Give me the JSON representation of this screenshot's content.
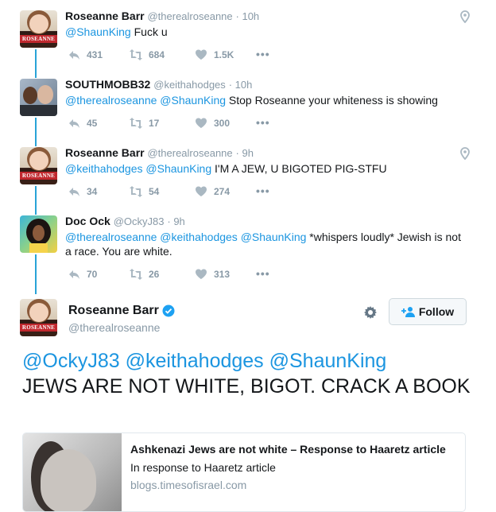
{
  "thread": [
    {
      "name": "Roseanne Barr",
      "handle": "@therealroseanne",
      "time": "· 10h",
      "mentions": [
        "@ShaunKing"
      ],
      "text": " Fuck u",
      "replies": "431",
      "retweets": "684",
      "likes": "1.5K",
      "avatar_label": "ROSEANNE"
    },
    {
      "name": "SOUTHMOBB32",
      "handle": "@keithahodges",
      "time": "· 10h",
      "mentions": [
        "@therealroseanne",
        "@ShaunKing"
      ],
      "text": " Stop Roseanne your whiteness is showing",
      "replies": "45",
      "retweets": "17",
      "likes": "300"
    },
    {
      "name": "Roseanne Barr",
      "handle": "@therealroseanne",
      "time": "· 9h",
      "mentions": [
        "@keithahodges",
        "@ShaunKing"
      ],
      "text": " I'M A JEW, U BIGOTED PIG-STFU",
      "replies": "34",
      "retweets": "54",
      "likes": "274",
      "avatar_label": "ROSEANNE"
    },
    {
      "name": "Doc Ock",
      "handle": "@OckyJ83",
      "time": "· 9h",
      "mentions": [
        "@therealroseanne",
        "@keithahodges",
        "@ShaunKing"
      ],
      "text": " *whispers loudly* Jewish is not",
      "text_line2": "a race. You are white.",
      "replies": "70",
      "retweets": "26",
      "likes": "313"
    }
  ],
  "main_tweet": {
    "name": "Roseanne Barr",
    "handle": "@therealroseanne",
    "follow_label": "Follow",
    "mentions": "@OckyJ83 @keithahodges @ShaunKing",
    "text": "JEWS ARE NOT WHITE, BIGOT. CRACK A BOOK",
    "avatar_label": "ROSEANNE"
  },
  "card": {
    "title": "Ashkenazi Jews are not white – Response to Haaretz article",
    "description": "In response to Haaretz article",
    "domain": "blogs.timesofisrael.com"
  },
  "colors": {
    "link": "#1b95e0",
    "thread_line": "#29a3d7",
    "muted": "#8899a6",
    "verified": "#1da1f2"
  }
}
